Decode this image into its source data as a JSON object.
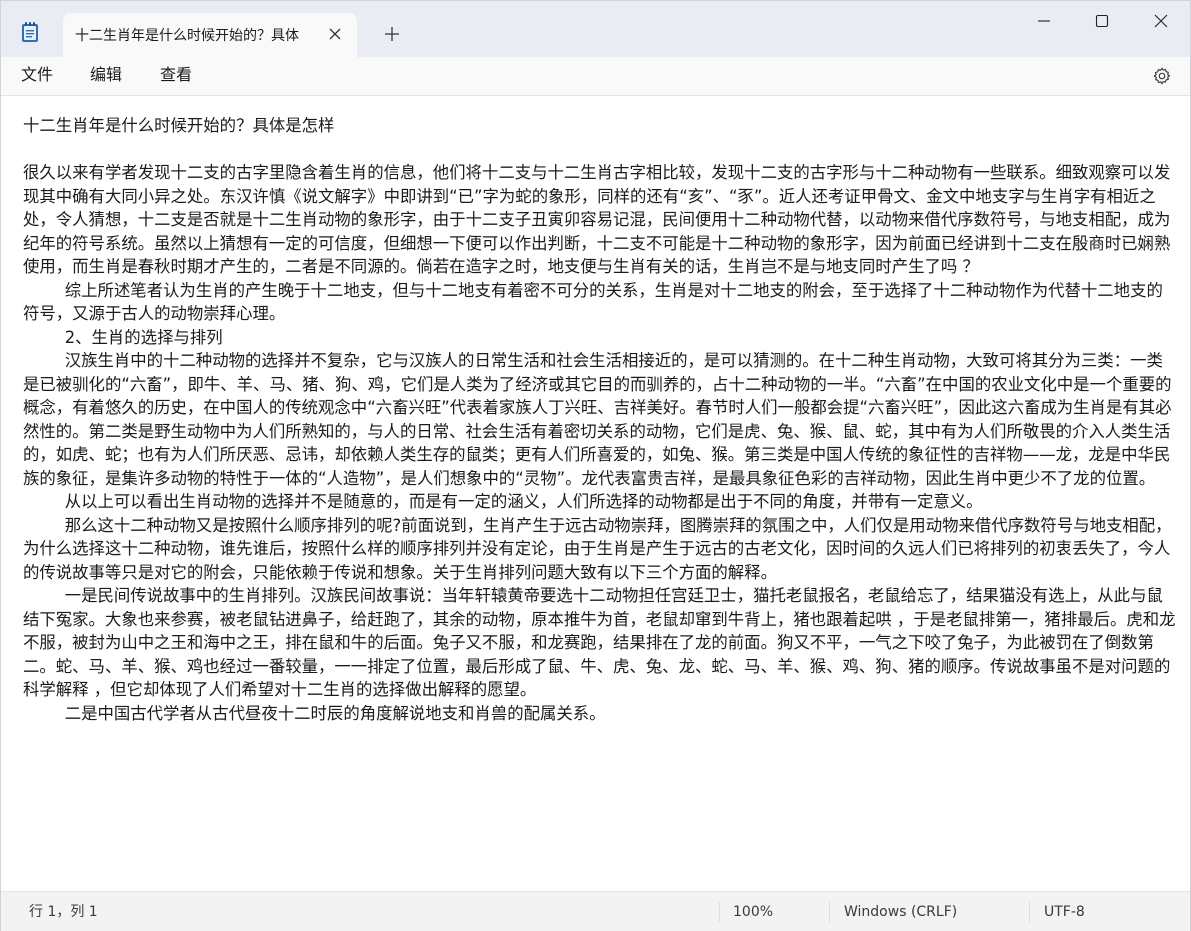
{
  "app": {
    "tab_title": "十二生肖年是什么时候开始的？具体",
    "accent": "#1d6fb8"
  },
  "menu": {
    "file": "文件",
    "edit": "编辑",
    "view": "查看"
  },
  "document": {
    "content": "十二生肖年是什么时候开始的？具体是怎样\n\n很久以来有学者发现十二支的古字里隐含着生肖的信息，他们将十二支与十二生肖古字相比较，发现十二支的古字形与十二种动物有一些联系。细致观察可以发现其中确有大同小异之处。东汉许慎《说文解字》中即讲到“已”字为蛇的象形，同样的还有“亥”、“豕”。近人还考证甲骨文、金文中地支字与生肖字有相近之处，令人猜想，十二支是否就是十二生肖动物的象形字，由于十二支子丑寅卯容易记混，民间便用十二种动物代替，以动物来借代序数符号，与地支相配，成为纪年的符号系统。虽然以上猜想有一定的可信度，但细想一下便可以作出判断，十二支不可能是十二种动物的象形字，因为前面已经讲到十二支在殷商时已娴熟使用，而生肖是春秋时期才产生的，二者是不同源的。倘若在造字之时，地支便与生肖有关的话，生肖岂不是与地支同时产生了吗 ？\n        综上所述笔者认为生肖的产生晚于十二地支，但与十二地支有着密不可分的关系，生肖是对十二地支的附会，至于选择了十二种动物作为代替十二地支的符号，又源于古人的动物崇拜心理。\n        2、生肖的选择与排列\n        汉族生肖中的十二种动物的选择并不复杂，它与汉族人的日常生活和社会生活相接近的，是可以猜测的。在十二种生肖动物，大致可将其分为三类：一类是已被驯化的“六畜”，即牛、羊、马、猪、狗、鸡，它们是人类为了经济或其它目的而驯养的，占十二种动物的一半。“六畜”在中国的农业文化中是一个重要的概念，有着悠久的历史，在中国人的传统观念中“六畜兴旺”代表着家族人丁兴旺、吉祥美好。春节时人们一般都会提“六畜兴旺”，因此这六畜成为生肖是有其必然性的。第二类是野生动物中为人们所熟知的，与人的日常、社会生活有着密切关系的动物，它们是虎、兔、猴、鼠、蛇，其中有为人们所敬畏的介入人类生活的，如虎、蛇；也有为人们所厌恶、忌讳，却依赖人类生存的鼠类；更有人们所喜爱的，如兔、猴。第三类是中国人传统的象征性的吉祥物——龙，龙是中华民族的象征，是集许多动物的特性于一体的“人造物”，是人们想象中的“灵物”。龙代表富贵吉祥，是最具象征色彩的吉祥动物，因此生肖中更少不了龙的位置。\n        从以上可以看出生肖动物的选择并不是随意的，而是有一定的涵义，人们所选择的动物都是出于不同的角度，并带有一定意义。\n        那么这十二种动物又是按照什么顺序排列的呢?前面说到，生肖产生于远古动物崇拜，图腾崇拜的氛围之中，人们仅是用动物来借代序数符号与地支相配，为什么选择这十二种动物，谁先谁后，按照什么样的顺序排列并没有定论，由于生肖是产生于远古的古老文化，因时间的久远人们已将排列的初衷丢失了，今人的传说故事等只是对它的附会，只能依赖于传说和想象。关于生肖排列问题大致有以下三个方面的解释。\n        一是民间传说故事中的生肖排列。汉族民间故事说：当年轩辕黄帝要选十二动物担任宫廷卫士，猫托老鼠报名，老鼠给忘了，结果猫没有选上，从此与鼠结下冤家。大象也来参赛，被老鼠钻进鼻子，给赶跑了，其余的动物，原本推牛为首，老鼠却窜到牛背上，猪也跟着起哄 ，于是老鼠排第一，猪排最后。虎和龙不服，被封为山中之王和海中之王，排在鼠和牛的后面。兔子又不服，和龙赛跑，结果排在了龙的前面。狗又不平，一气之下咬了兔子，为此被罚在了倒数第二。蛇、马、羊、猴、鸡也经过一番较量，一一排定了位置，最后形成了鼠、牛、虎、兔、龙、蛇、马、羊、猴、鸡、狗、猪的顺序。传说故事虽不是对问题的科学解释 ，但它却体现了人们希望对十二生肖的选择做出解释的愿望。\n        二是中国古代学者从古代昼夜十二时辰的角度解说地支和肖兽的配属关系。"
  },
  "status": {
    "position": "行 1，列 1",
    "zoom": "100%",
    "line_ending": "Windows (CRLF)",
    "encoding": "UTF-8"
  }
}
